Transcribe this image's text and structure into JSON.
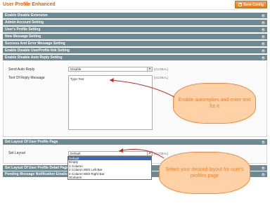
{
  "page": {
    "title": "User Profile Enhanced",
    "save_label": "Save Config"
  },
  "sections": [
    {
      "label": "Enable Disable Extension"
    },
    {
      "label": "Admin Account Setting"
    },
    {
      "label": "User's Profile Setting"
    },
    {
      "label": "New Message Setting"
    },
    {
      "label": "Success And Error Message Setting"
    },
    {
      "label": "Enable Disable UserProfile link Setting"
    },
    {
      "label": "Enable Disable Auto Reply Setting"
    }
  ],
  "auto_reply": {
    "send_label": "Send Auto Reply",
    "send_value": "Disable",
    "send_scope": "[GLOBAL]",
    "text_label": "Text Of Reply Message",
    "text_value": "Type Text",
    "text_scope": "[GLOBAL]"
  },
  "layout_section": {
    "label": "Set Layout Of User Profile Page",
    "field_label": "Set Layout",
    "value": "Default",
    "scope": "[GLOBAL]",
    "options": [
      "Default",
      "Empty",
      "1 Column",
      "2 Column With Left Bar",
      "2 Column With Right Bar",
      "3Column"
    ]
  },
  "bottom_sections": [
    {
      "label": "Set Layout Of User Profile Detail Page"
    },
    {
      "label": "Pending Message Notification Emails Se..."
    }
  ],
  "callouts": {
    "autoreply": "Enable autoreplies and enter text for it",
    "layout": "Select your desired layout for user's profiles page"
  },
  "colors": {
    "section_bg": "#6f8992",
    "accent": "#eb5e00",
    "callout_fill": "#ffd1a6",
    "callout_text": "#ef7f2a"
  }
}
